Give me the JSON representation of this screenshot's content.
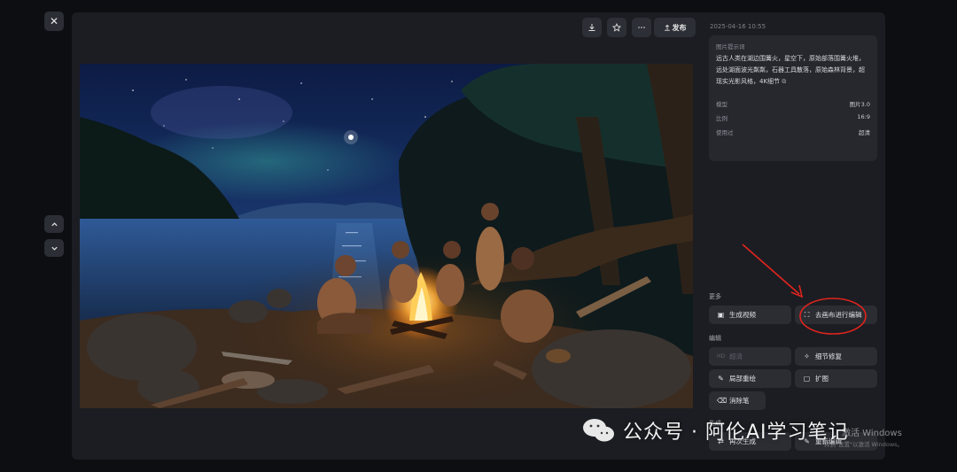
{
  "toolbar": {
    "publish_label": "发布"
  },
  "side": {
    "date": "2025-04-16 10:55",
    "prompt_label": "图片提示词",
    "prompt_text": "远古人类在湖边围篝火，星空下，原始部落围篝火堆，远处湖面波光粼粼，石器工具散落，原始森林背景，超现实光影风格，4K细节",
    "meta": [
      {
        "key": "模型",
        "value": "图片3.0"
      },
      {
        "key": "比例",
        "value": "16:9"
      },
      {
        "key": "使用过",
        "value": "超清"
      }
    ],
    "sections": {
      "more": "更多",
      "edit": "编辑",
      "generate": "生成"
    },
    "actions": {
      "gen_video": "生成视频",
      "canvas_edit": "去画布进行编辑",
      "hd": "超清",
      "detail_fix": "细节修复",
      "local_redraw": "局部重绘",
      "expand": "扩图",
      "eraser": "消除笔",
      "regenerate": "再次生成",
      "re_edit": "重新编辑"
    }
  },
  "watermark": {
    "text": "公众号 · 阿伦AI学习笔记",
    "win_line1": "激活 Windows",
    "win_line2": "转到\"设置\"以激活 Windows。"
  },
  "colors": {
    "panel": "#1c1d22",
    "button": "#2b2d33",
    "annotation_red": "#e0241e"
  }
}
